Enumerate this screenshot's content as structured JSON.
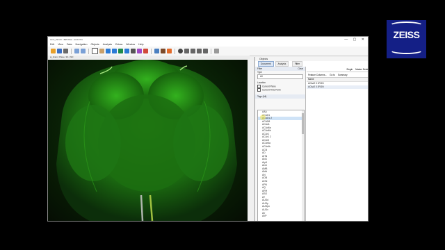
{
  "window": {
    "title": "zenx_Vid.czi - ZEN blue - arivis Pro"
  },
  "menu": [
    "Edit",
    "View",
    "Data",
    "Navigation",
    "Objects",
    "Analysis",
    "Extras",
    "Window",
    "Help"
  ],
  "image_tab": {
    "label": "ig_brain | Plane: 3/1 | ND"
  },
  "objects_panel": {
    "title": "Objects",
    "tabs": [
      "Document",
      "Analysis"
    ],
    "filter_button": "Filter",
    "filter_section": "Filter",
    "clear_label": "Clear",
    "type_label": "Type",
    "type_value": "All",
    "location_label": "Location",
    "location_options": [
      "Current Plane",
      "Current Time Point"
    ],
    "tags_label": "Tags (All)",
    "tags": [
      "AAA",
      "ACAD1",
      "ACAD1 2",
      "ACAD8",
      "ACAd1",
      "ACAd6a",
      "ACAd6b",
      "ACAr1",
      "ACAr1 2",
      "ACAr5",
      "ACAr6a",
      "ACAr6b",
      "ACB",
      "AD",
      "AHN",
      "AId1",
      "AIp5",
      "AIv6",
      "AMB",
      "AMd",
      "AN",
      "AOB",
      "AON",
      "APN",
      "AQ",
      "ARH",
      "ASO",
      "AT",
      "AUDd",
      "AUDp",
      "AUDpo",
      "AUDv",
      "AV",
      "AVP"
    ],
    "selected_tag_index": 2,
    "right_toolbar": {
      "single": "Single",
      "master_detail": "Master Detail"
    },
    "feature_bar": {
      "feature_columns": "Feature Columns...",
      "go_to": "Go to",
      "summary": "Summary"
    },
    "name_header": "Name",
    "rows": [
      "ACAd2 3 1RGN",
      "ACAd2 3 2RGN"
    ]
  },
  "logo": {
    "text": "ZEISS"
  },
  "colors": {
    "fluorescence": "#2ea81a",
    "accent": "#141f86"
  }
}
